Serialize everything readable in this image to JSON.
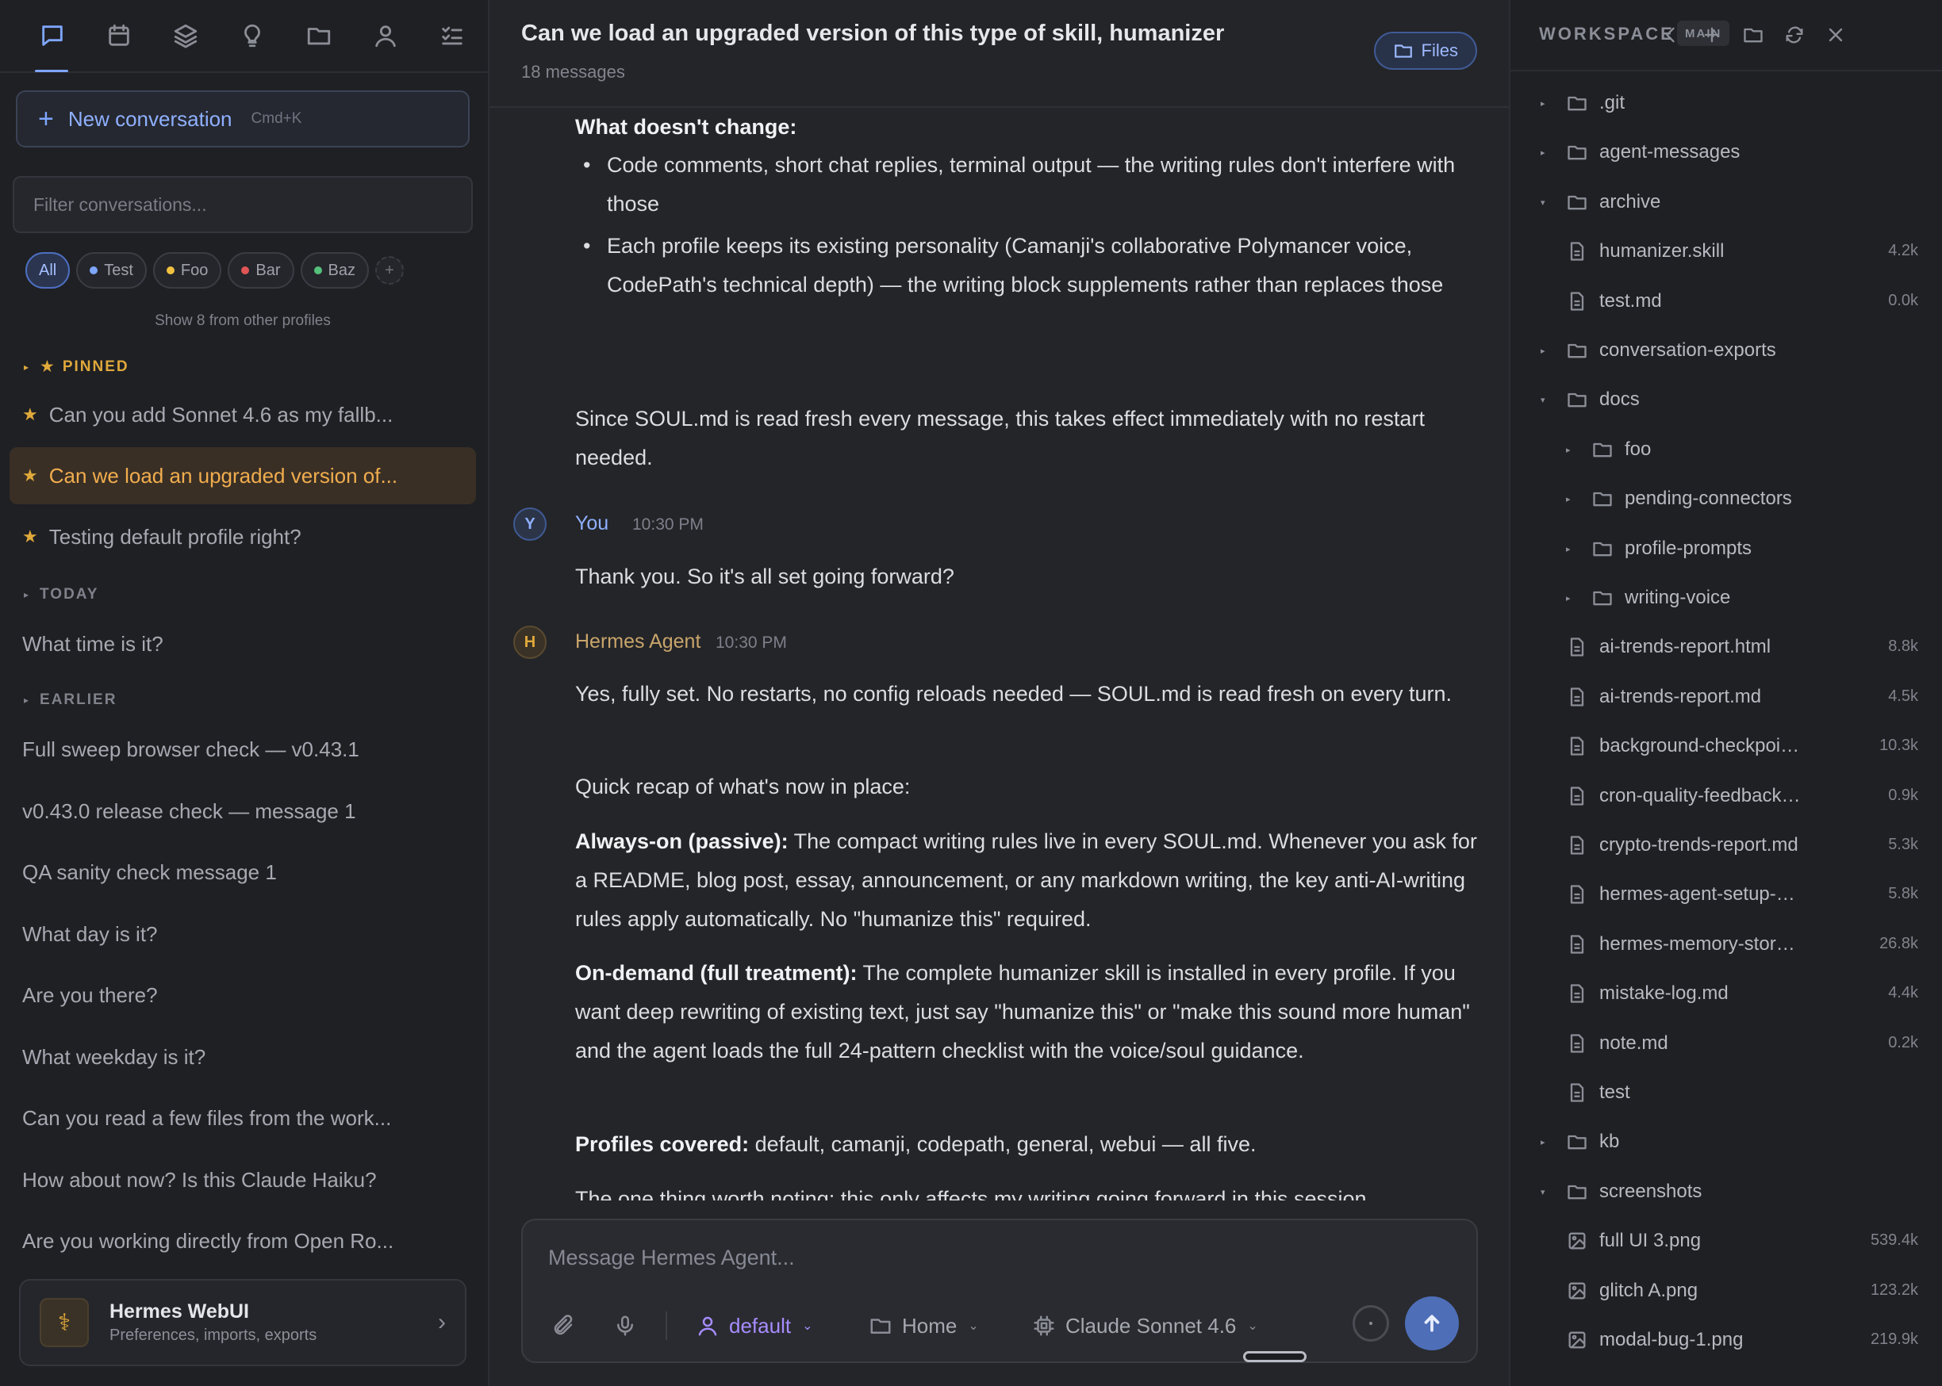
{
  "sidebar": {
    "new_conversation": {
      "label": "New conversation",
      "shortcut": "Cmd+K"
    },
    "filter_placeholder": "Filter conversations...",
    "chips": [
      {
        "label": "All",
        "color": ""
      },
      {
        "label": "Test",
        "color": "#7ea6ff"
      },
      {
        "label": "Foo",
        "color": "#f0c040"
      },
      {
        "label": "Bar",
        "color": "#e05555"
      },
      {
        "label": "Baz",
        "color": "#55c07a"
      }
    ],
    "chip_add": "+",
    "show_other": "Show 8 from other profiles",
    "sections": {
      "pinned": "PINNED",
      "today": "TODAY",
      "earlier": "EARLIER"
    },
    "pinned": [
      "Can you add Sonnet 4.6 as my fallb...",
      "Can we load an upgraded version of...",
      "Testing default profile right?"
    ],
    "today": [
      "What time is it?"
    ],
    "earlier": [
      "Full sweep browser check — v0.43.1",
      "v0.43.0 release check — message 1",
      "QA sanity check message 1",
      "What day is it?",
      "Are you there?",
      "What weekday is it?",
      "Can you read a few files from the work...",
      "How about now? Is this Claude Haiku?",
      "Are you working directly from Open Ro..."
    ],
    "prefs": {
      "title": "Hermes WebUI",
      "subtitle": "Preferences, imports, exports"
    }
  },
  "main": {
    "title": "Can we load an upgraded version of this type of skill, humanizer",
    "subtitle": "18 messages",
    "files_button": "Files",
    "messages": {
      "heading_no_change": "What doesn't change:",
      "bullet1": "Code comments, short chat replies, terminal output — the writing rules don't interfere with those",
      "bullet2": "Each profile keeps its existing personality (Camanji's collaborative Polymancer voice, CodePath's technical depth) — the writing block supplements rather than replaces those",
      "para_soul": "Since SOUL.md is read fresh every message, this takes effect immediately with no restart needed.",
      "user_initial": "Y",
      "user_name": "You",
      "user_time": "10:30 PM",
      "user_text": "Thank you. So it's all set going forward?",
      "agent_initial": "H",
      "agent_name": "Hermes Agent",
      "agent_time": "10:30 PM",
      "agent_p1": "Yes, fully set. No restarts, no config reloads needed — SOUL.md is read fresh on every turn.",
      "agent_p2": "Quick recap of what's now in place:",
      "agent_p3_bold": "Always-on (passive):",
      "agent_p3": " The compact writing rules live in every SOUL.md. Whenever you ask for a README, blog post, essay, announcement, or any markdown writing, the key anti-AI-writing rules apply automatically. No \"humanize this\" required.",
      "agent_p4_bold": "On-demand (full treatment):",
      "agent_p4": " The complete humanizer skill is installed in every profile. If you want deep rewriting of existing text, just say \"humanize this\" or \"make this sound more human\" and the agent loads the full 24-pattern checklist with the voice/soul guidance.",
      "agent_p5_bold": "Profiles covered:",
      "agent_p5": " default, camanji, codepath, general, webui — all five.",
      "agent_p6": "The one thing worth noting: this only affects my writing going forward in this session"
    },
    "composer": {
      "placeholder": "Message Hermes Agent...",
      "profile": "default",
      "folder": "Home",
      "model": "Claude Sonnet 4.6"
    }
  },
  "workspace": {
    "title": "WORKSPACE",
    "badge": "MAIN",
    "items": [
      {
        "name": ".git",
        "type": "folder",
        "depth": 0,
        "open": false,
        "size": ""
      },
      {
        "name": "agent-messages",
        "type": "folder",
        "depth": 0,
        "open": false,
        "size": ""
      },
      {
        "name": "archive",
        "type": "folder",
        "depth": 0,
        "open": true,
        "size": ""
      },
      {
        "name": "humanizer.skill",
        "type": "file",
        "depth": 1,
        "size": "4.2k"
      },
      {
        "name": "test.md",
        "type": "file",
        "depth": 1,
        "size": "0.0k"
      },
      {
        "name": "conversation-exports",
        "type": "folder",
        "depth": 0,
        "open": false,
        "size": ""
      },
      {
        "name": "docs",
        "type": "folder",
        "depth": 0,
        "open": true,
        "size": ""
      },
      {
        "name": "foo",
        "type": "folder",
        "depth": 1,
        "open": false,
        "size": ""
      },
      {
        "name": "pending-connectors",
        "type": "folder",
        "depth": 1,
        "open": false,
        "size": ""
      },
      {
        "name": "profile-prompts",
        "type": "folder",
        "depth": 1,
        "open": false,
        "size": ""
      },
      {
        "name": "writing-voice",
        "type": "folder",
        "depth": 1,
        "open": false,
        "size": ""
      },
      {
        "name": "ai-trends-report.html",
        "type": "file",
        "depth": 1,
        "size": "8.8k"
      },
      {
        "name": "ai-trends-report.md",
        "type": "file",
        "depth": 1,
        "size": "4.5k"
      },
      {
        "name": "background-checkpoint-sy...",
        "type": "file",
        "depth": 1,
        "size": "10.3k"
      },
      {
        "name": "cron-quality-feedback.md",
        "type": "file",
        "depth": 1,
        "size": "0.9k"
      },
      {
        "name": "crypto-trends-report.md",
        "type": "file",
        "depth": 1,
        "size": "5.3k"
      },
      {
        "name": "hermes-agent-setup-guide....",
        "type": "file",
        "depth": 1,
        "size": "5.8k"
      },
      {
        "name": "hermes-memory-stores.md",
        "type": "file",
        "depth": 1,
        "size": "26.8k"
      },
      {
        "name": "mistake-log.md",
        "type": "file",
        "depth": 1,
        "size": "4.4k"
      },
      {
        "name": "note.md",
        "type": "file",
        "depth": 1,
        "size": "0.2k"
      },
      {
        "name": "test",
        "type": "file",
        "depth": 1,
        "size": ""
      },
      {
        "name": "kb",
        "type": "folder",
        "depth": 0,
        "open": false,
        "size": ""
      },
      {
        "name": "screenshots",
        "type": "folder",
        "depth": 0,
        "open": true,
        "size": ""
      },
      {
        "name": "full UI 3.png",
        "type": "image",
        "depth": 1,
        "size": "539.4k"
      },
      {
        "name": "glitch A.png",
        "type": "image",
        "depth": 1,
        "size": "123.2k"
      },
      {
        "name": "modal-bug-1.png",
        "type": "image",
        "depth": 1,
        "size": "219.9k"
      }
    ]
  }
}
